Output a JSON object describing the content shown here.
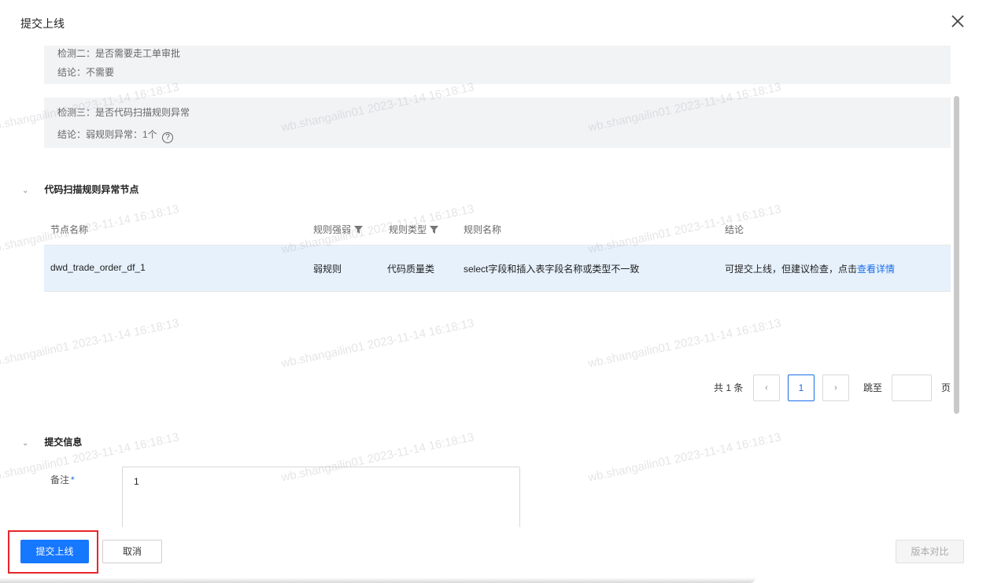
{
  "dialog": {
    "title": "提交上线"
  },
  "checks": [
    {
      "title": "检测二：是否需要走工单审批",
      "conclusion": "结论：不需要"
    },
    {
      "title": "检测三：是否代码扫描规则异常",
      "conclusion": "结论：弱规则异常：1个",
      "help_icon": "?"
    }
  ],
  "scan_section": {
    "title": "代码扫描规则异常节点",
    "columns": [
      "节点名称",
      "规则强弱",
      "规则类型",
      "规则名称",
      "结论"
    ],
    "rows": [
      {
        "node": "dwd_trade_order_df_1",
        "strength": "弱规则",
        "type": "代码质量类",
        "rule": "select字段和插入表字段名称或类型不一致",
        "conclusion": "可提交上线，但建议检查，点击",
        "detail_link": "查看详情"
      }
    ]
  },
  "pagination": {
    "total": "共 1 条",
    "prev": "‹",
    "page": "1",
    "next": "›",
    "jump_label": "跳至",
    "page_suffix": "页"
  },
  "submit_section": {
    "title": "提交信息",
    "remark_label": "备注",
    "required_mark": "*",
    "remark_value": "1"
  },
  "footer": {
    "submit": "提交上线",
    "cancel": "取消",
    "compare": "版本对比"
  },
  "watermark": "wb.shangailin01 2023-11-14 16:18:13",
  "colors": {
    "primary": "#1677ff",
    "link": "#1a6ee8",
    "row_highlight": "#e6f1fc",
    "check_bg": "#f2f3f5",
    "annotation": "#e8262a"
  }
}
